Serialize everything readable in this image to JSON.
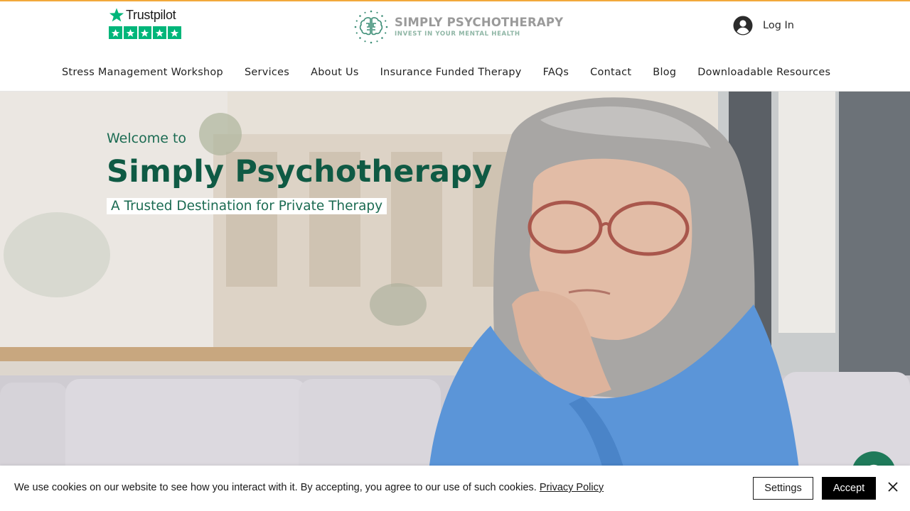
{
  "header": {
    "trustpilot": {
      "wordmark": "Trustpilot",
      "stars": 5,
      "star_color": "#00b67a"
    },
    "brand": {
      "name": "SIMPLY PSYCHOTHERAPY",
      "tagline": "INVEST IN YOUR MENTAL HEALTH"
    },
    "login": {
      "label": "Log In",
      "icon": "user-avatar-icon"
    }
  },
  "nav": {
    "items": [
      {
        "label": "Stress Management Workshop"
      },
      {
        "label": "Services"
      },
      {
        "label": "About Us"
      },
      {
        "label": "Insurance Funded Therapy"
      },
      {
        "label": "FAQs"
      },
      {
        "label": "Contact"
      },
      {
        "label": "Blog"
      },
      {
        "label": "Downloadable Resources"
      }
    ]
  },
  "hero": {
    "welcome": "Welcome to",
    "title": "Simply Psychotherapy",
    "subtitle": "A Trusted Destination for Private Therapy"
  },
  "chat": {
    "icon": "chat-icon"
  },
  "cookie": {
    "text": "We use cookies on our website to see how you interact with it. By accepting, you agree to our use of such cookies.",
    "link": "Privacy Policy",
    "settings_label": "Settings",
    "accept_label": "Accept",
    "close_icon": "close-icon"
  },
  "colors": {
    "brand_green": "#0f5a44",
    "accent_orange": "#f2a93b",
    "trustpilot_green": "#00b67a"
  }
}
